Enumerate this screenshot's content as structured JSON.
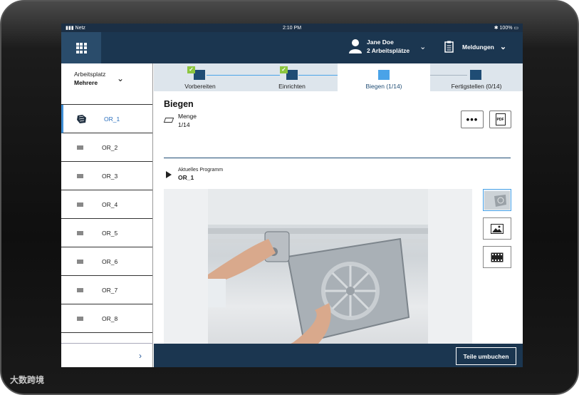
{
  "status_bar": {
    "carrier": "Netz",
    "time": "2:10 PM",
    "battery": "100%"
  },
  "topbar": {
    "user_name": "Jane Doe",
    "user_sub": "2 Arbeitsplätze",
    "messages_label": "Meldungen"
  },
  "sidebar": {
    "workspace_label": "Arbeitsplatz",
    "workspace_value": "Mehrere",
    "items": [
      {
        "label": "OR_1"
      },
      {
        "label": "OR_2"
      },
      {
        "label": "OR_3"
      },
      {
        "label": "OR_4"
      },
      {
        "label": "OR_5"
      },
      {
        "label": "OR_6"
      },
      {
        "label": "OR_7"
      },
      {
        "label": "OR_8"
      }
    ],
    "next_label": "›"
  },
  "stepper": {
    "steps": [
      {
        "label": "Vorbereiten",
        "done": true
      },
      {
        "label": "Einrichten",
        "done": true
      },
      {
        "label": "Biegen (1/14)",
        "active": true
      },
      {
        "label": "Fertigstellen (0/14)"
      }
    ]
  },
  "main": {
    "title": "Biegen",
    "menge_label": "Menge",
    "menge_value": "1/14",
    "more_label": "•••",
    "pdf_label": "PDF",
    "program_label": "Aktuelles Programm",
    "program_value": "OR_1"
  },
  "footer": {
    "button_label": "Teile umbuchen"
  },
  "watermark": "大数跨境",
  "colors": {
    "navy": "#1b3650",
    "accent": "#4aa3e8",
    "check": "#8cc63f"
  }
}
